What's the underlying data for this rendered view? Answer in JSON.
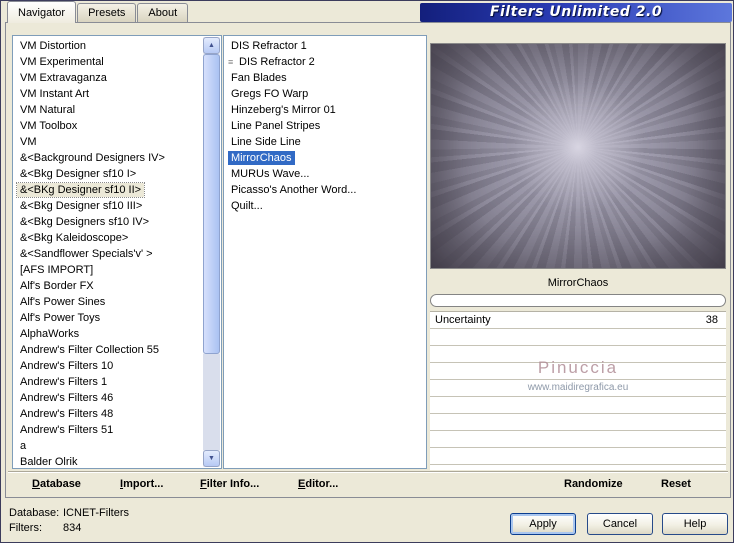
{
  "window": {
    "title": "Filters Unlimited 2.0"
  },
  "tabs": [
    {
      "label": "Navigator",
      "selected": true
    },
    {
      "label": "Presets"
    },
    {
      "label": "About"
    }
  ],
  "categories": {
    "items": [
      {
        "label": "VM Distortion"
      },
      {
        "label": "VM Experimental"
      },
      {
        "label": "VM Extravaganza"
      },
      {
        "label": "VM Instant Art"
      },
      {
        "label": "VM Natural"
      },
      {
        "label": "VM Toolbox"
      },
      {
        "label": "VM"
      },
      {
        "label": "&<Background Designers IV>"
      },
      {
        "label": "&<Bkg Designer sf10 I>"
      },
      {
        "label": "&<BKg Designer sf10 II>",
        "selected": true
      },
      {
        "label": "&<Bkg Designer sf10 III>"
      },
      {
        "label": "&<Bkg Designers sf10 IV>"
      },
      {
        "label": "&<Bkg Kaleidoscope>"
      },
      {
        "label": "&<Sandflower Specials'v' >"
      },
      {
        "label": "[AFS IMPORT]"
      },
      {
        "label": "Alf's Border FX"
      },
      {
        "label": "Alf's Power Sines"
      },
      {
        "label": "Alf's Power Toys"
      },
      {
        "label": "AlphaWorks"
      },
      {
        "label": "Andrew's Filter Collection 55"
      },
      {
        "label": "Andrew's Filters 10"
      },
      {
        "label": "Andrew's Filters 1"
      },
      {
        "label": "Andrew's Filters 46"
      },
      {
        "label": "Andrew's Filters 48"
      },
      {
        "label": "Andrew's Filters 51"
      },
      {
        "label": "a"
      },
      {
        "label": "Balder Olrik"
      }
    ]
  },
  "filters": {
    "items": [
      {
        "label": "DIS Refractor 1"
      },
      {
        "label": "DIS Refractor 2",
        "icon": "list-marker-icon"
      },
      {
        "label": "Fan Blades"
      },
      {
        "label": "Gregs FO Warp"
      },
      {
        "label": "Hinzeberg's Mirror 01"
      },
      {
        "label": "Line Panel Stripes"
      },
      {
        "label": "Line Side Line"
      },
      {
        "label": "MirrorChaos",
        "selected": true
      },
      {
        "label": "MURUs Wave..."
      },
      {
        "label": "Picasso's Another Word..."
      },
      {
        "label": "Quilt..."
      }
    ]
  },
  "preview": {
    "selected_filter": "MirrorChaos"
  },
  "params": [
    {
      "name": "Uncertainty",
      "value": "38"
    }
  ],
  "watermark": {
    "name": "Pinuccia",
    "url": "www.maidiregrafica.eu"
  },
  "toolbar": {
    "database": {
      "u": "D",
      "rest": "atabase"
    },
    "import": {
      "u": "I",
      "rest": "mport..."
    },
    "filter_info": {
      "u": "F",
      "rest": "ilter Info..."
    },
    "editor": {
      "u": "E",
      "rest": "ditor..."
    },
    "randomize": "Randomize",
    "reset": "Reset"
  },
  "status": {
    "database_label": "Database:",
    "database_value": "ICNET-Filters",
    "filters_label": "Filters:",
    "filters_value": "834"
  },
  "buttons": {
    "apply": "Apply",
    "cancel": "Cancel",
    "help": "Help"
  }
}
